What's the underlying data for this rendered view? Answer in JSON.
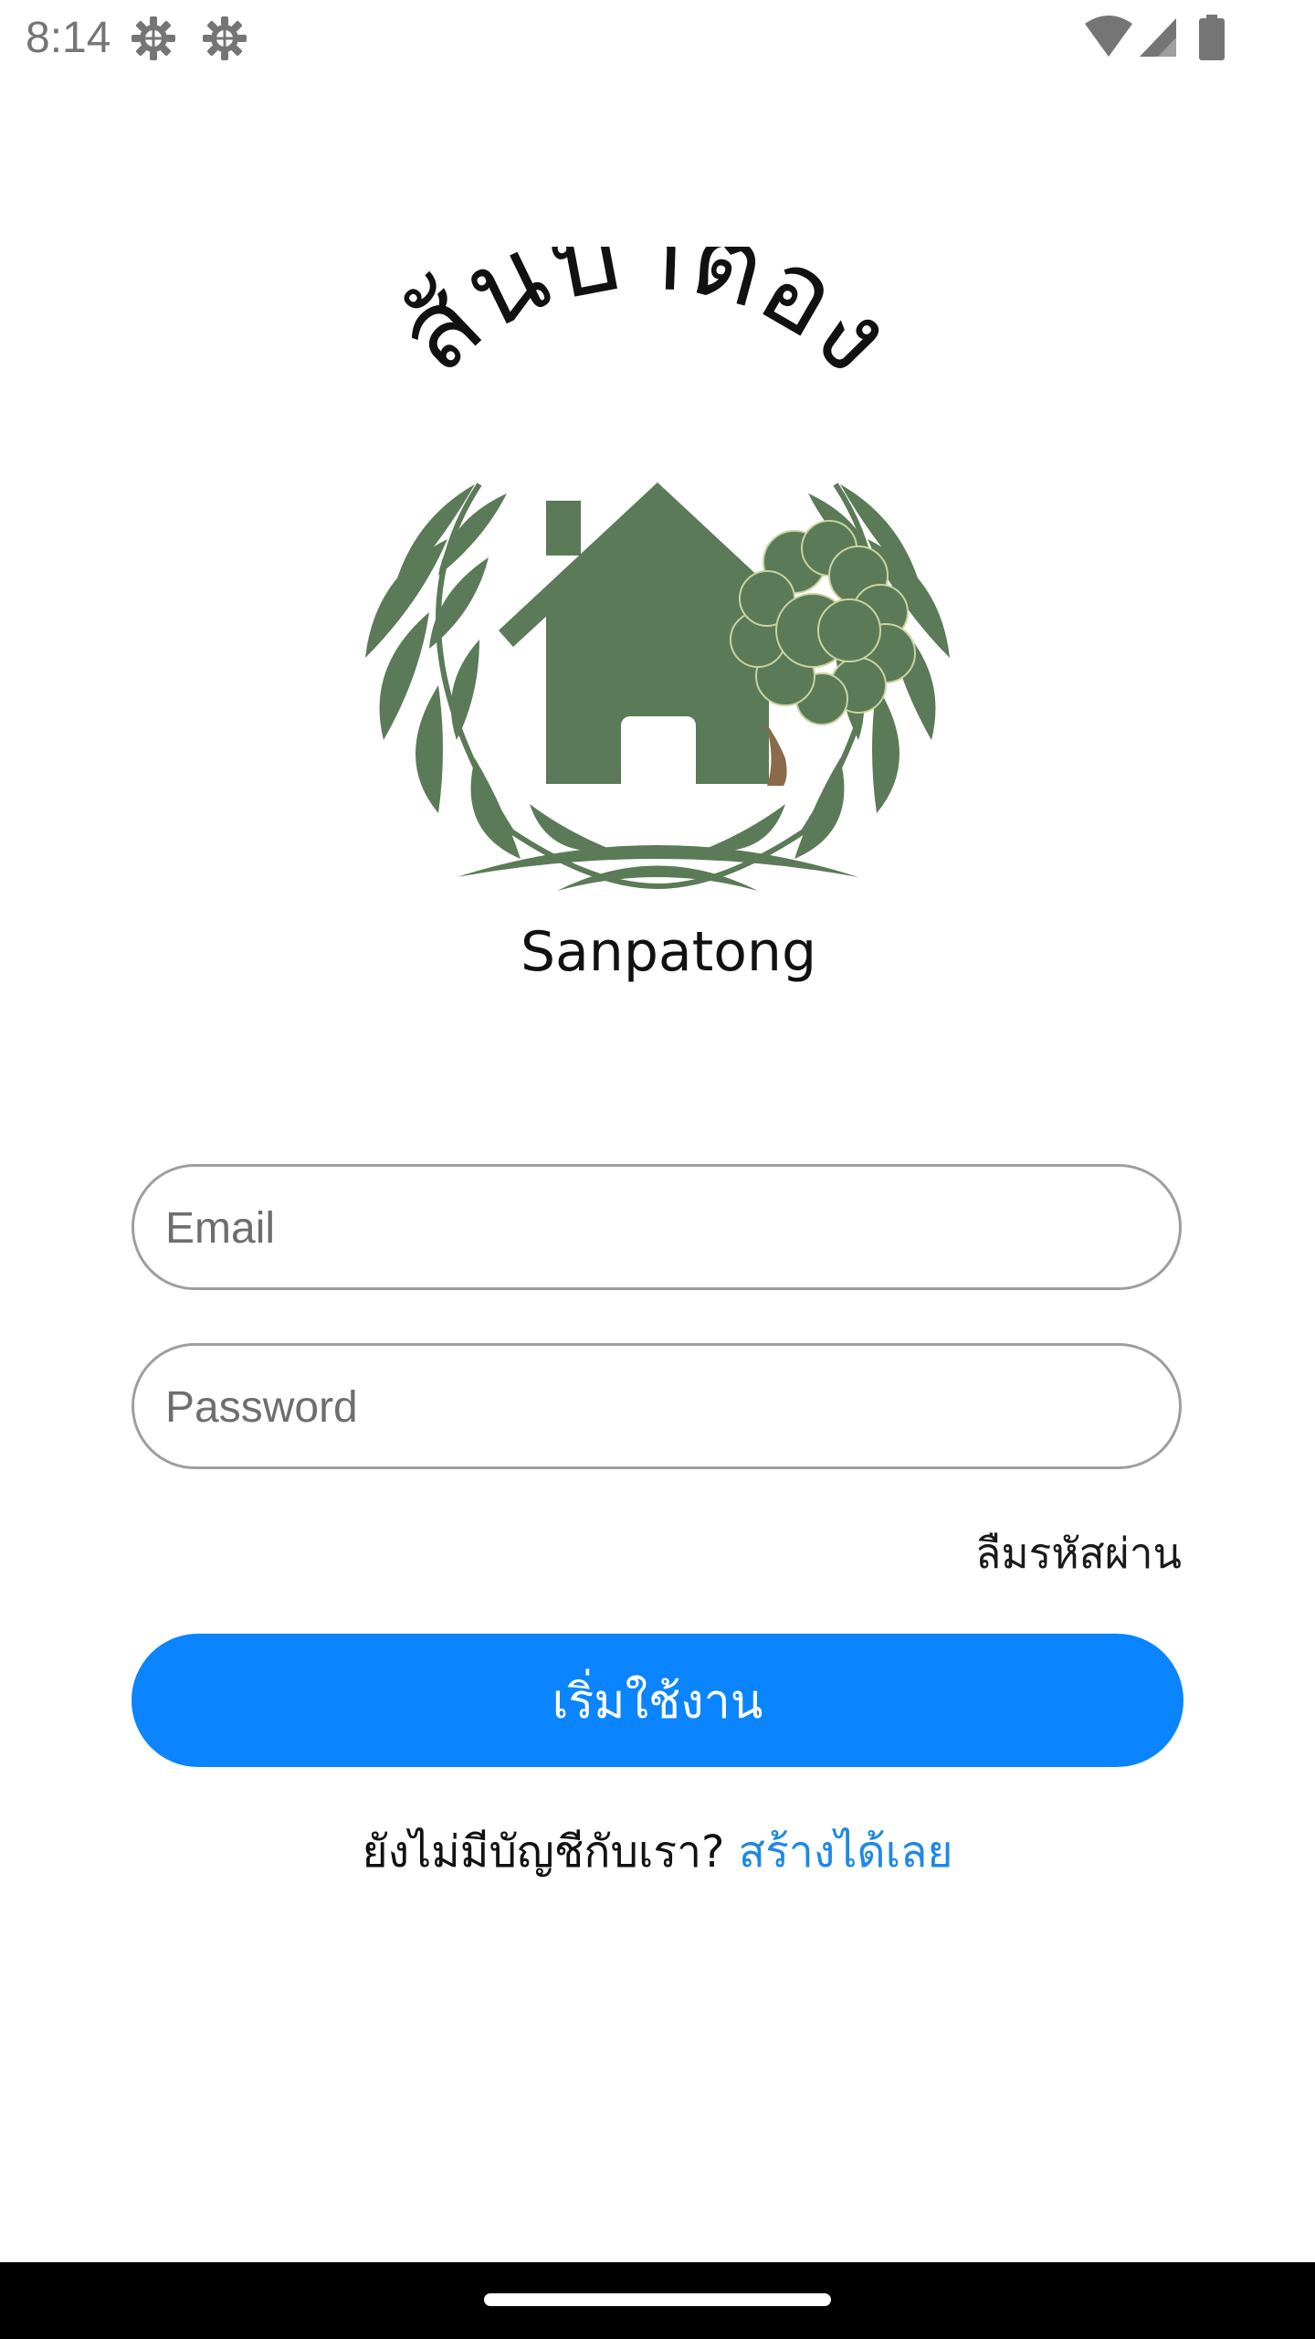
{
  "status_bar": {
    "time": "8:14",
    "icons": [
      "settings-gear-icon",
      "settings-gear-icon",
      "wifi-icon",
      "cell-signal-icon",
      "battery-icon"
    ]
  },
  "logo": {
    "thai_name": "สันป่าตอง",
    "english_name": "Sanpatong",
    "brand_color": "#5b7a57"
  },
  "form": {
    "email_placeholder": "Email",
    "password_placeholder": "Password",
    "forgot_password": "ลืมรหัสผ่าน",
    "start_button": "เริ่มใช้งาน",
    "no_account_text": "ยังไม่มีบัญชีกับเรา?",
    "create_link": "สร้างได้เลย"
  },
  "colors": {
    "primary": "#0a84ff",
    "link": "#1e88e5",
    "field_border": "#9e9e9e"
  }
}
